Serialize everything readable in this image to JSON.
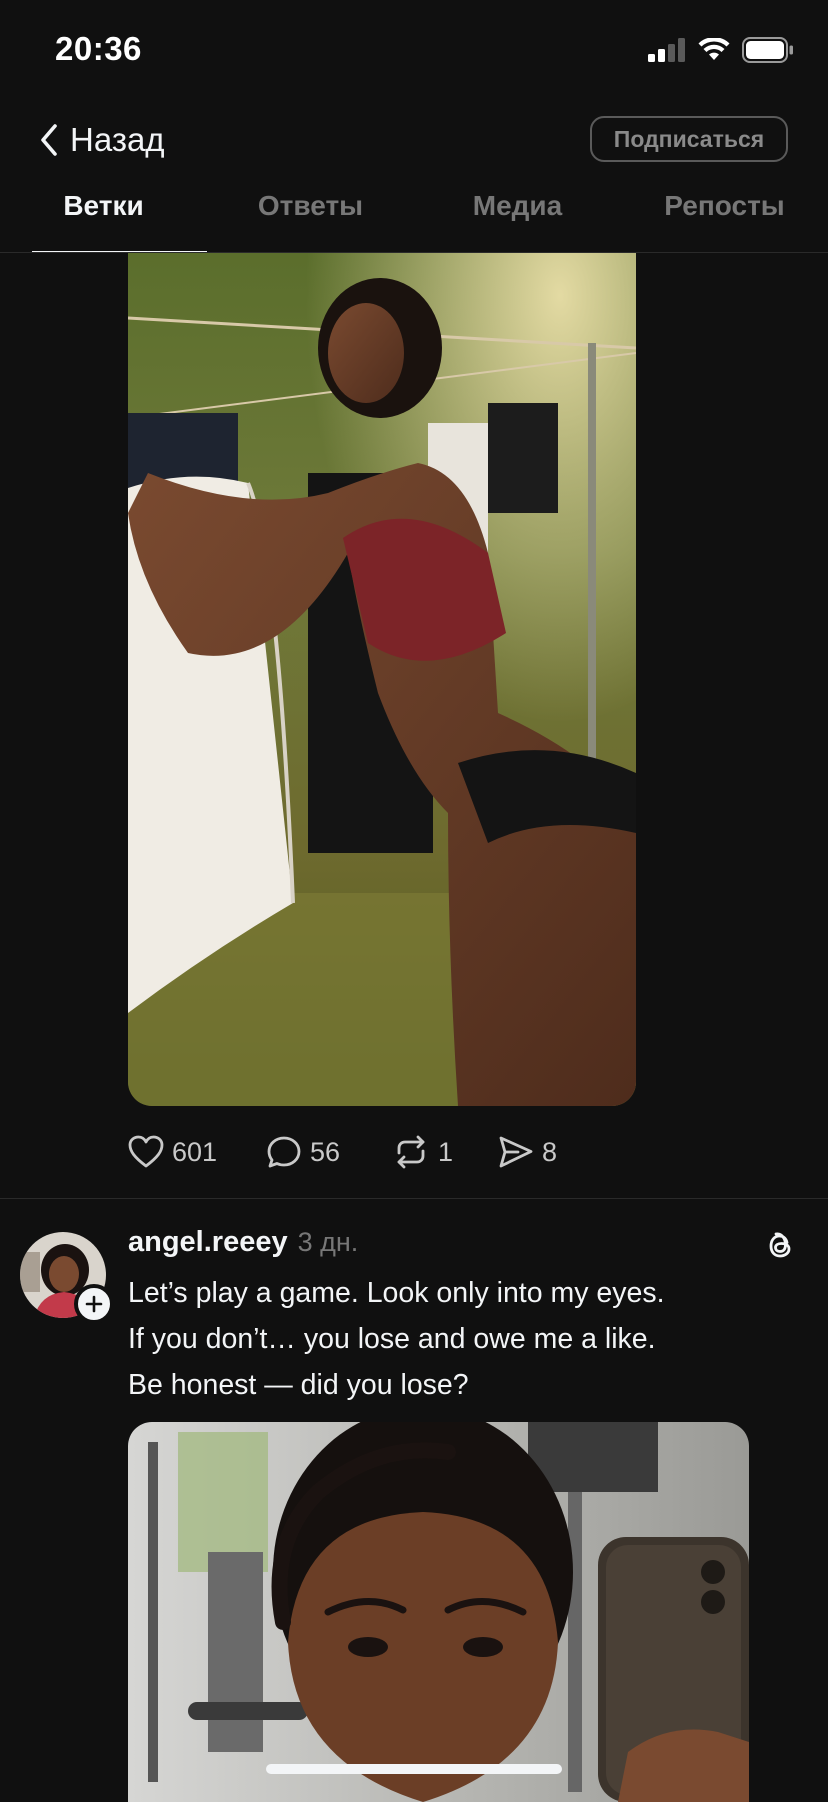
{
  "status_bar": {
    "time": "20:36",
    "icons": [
      "signal-icon",
      "wifi-icon",
      "battery-icon"
    ]
  },
  "nav": {
    "back_label": "Назад",
    "subscribe_label": "Подписаться"
  },
  "tabs": [
    {
      "label": "Ветки",
      "active": true
    },
    {
      "label": "Ответы",
      "active": false
    },
    {
      "label": "Медиа",
      "active": false
    },
    {
      "label": "Репосты",
      "active": false
    }
  ],
  "post1": {
    "image_icon": "photo-woman-laundry",
    "likes": "601",
    "comments": "56",
    "reposts": "1",
    "shares": "8"
  },
  "post2": {
    "username": "angel.reeey",
    "time": "3 дн.",
    "text_lines": [
      "Let’s play a game. Look only into my eyes.",
      "If you don’t… you lose and owe me a like.",
      "Be honest — did you lose?"
    ],
    "image_icon": "photo-gym-selfie"
  },
  "colors": {
    "background": "#101010",
    "text_primary": "#f3f5f7",
    "text_secondary": "#777777",
    "divider": "#2a2a2a"
  }
}
